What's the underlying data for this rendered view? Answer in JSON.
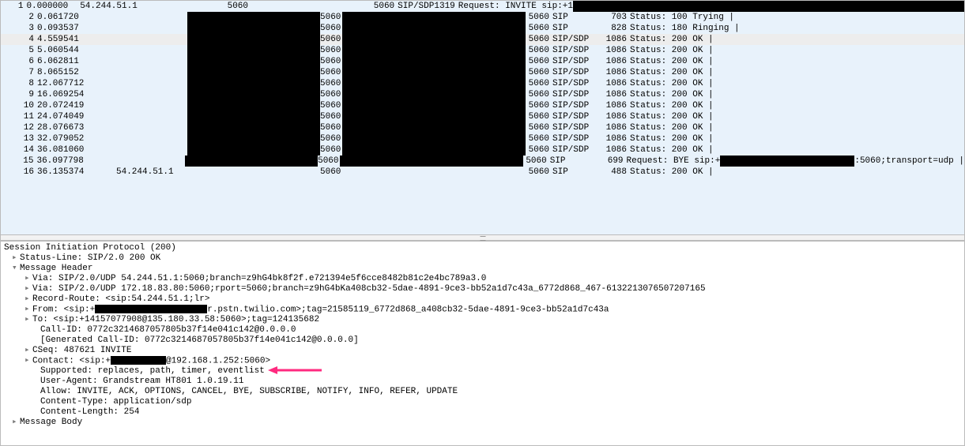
{
  "packets": [
    {
      "no": "1",
      "time": "0.000000",
      "src": "54.244.51.1",
      "srcRedacted": false,
      "port1": "5060",
      "port2": "5060",
      "proto": "SIP/SDP",
      "len": "1319",
      "info_pre": "Request: INVITE sip:+1",
      "info_redact_w": 495,
      "info_post": "",
      "sel": false
    },
    {
      "no": "2",
      "time": "0.061720",
      "src": "",
      "srcRedacted": true,
      "port1": "5060",
      "port2": "5060",
      "proto": "SIP",
      "len": "703",
      "info_pre": "Status: 100 Trying |",
      "info_redact_w": 0,
      "info_post": "",
      "sel": false
    },
    {
      "no": "3",
      "time": "0.093537",
      "src": "",
      "srcRedacted": true,
      "port1": "5060",
      "port2": "5060",
      "proto": "SIP",
      "len": "828",
      "info_pre": "Status: 180 Ringing |",
      "info_redact_w": 0,
      "info_post": "",
      "sel": false
    },
    {
      "no": "4",
      "time": "4.559541",
      "src": "",
      "srcRedacted": true,
      "port1": "5060",
      "port2": "5060",
      "proto": "SIP/SDP",
      "len": "1086",
      "info_pre": "Status: 200 OK |",
      "info_redact_w": 0,
      "info_post": "",
      "sel": true
    },
    {
      "no": "5",
      "time": "5.060544",
      "src": "",
      "srcRedacted": true,
      "port1": "5060",
      "port2": "5060",
      "proto": "SIP/SDP",
      "len": "1086",
      "info_pre": "Status: 200 OK |",
      "info_redact_w": 0,
      "info_post": "",
      "sel": false
    },
    {
      "no": "6",
      "time": "6.062811",
      "src": "",
      "srcRedacted": true,
      "port1": "5060",
      "port2": "5060",
      "proto": "SIP/SDP",
      "len": "1086",
      "info_pre": "Status: 200 OK |",
      "info_redact_w": 0,
      "info_post": "",
      "sel": false
    },
    {
      "no": "7",
      "time": "8.065152",
      "src": "",
      "srcRedacted": true,
      "port1": "5060",
      "port2": "5060",
      "proto": "SIP/SDP",
      "len": "1086",
      "info_pre": "Status: 200 OK |",
      "info_post": "",
      "info_redact_w": 0,
      "sel": false
    },
    {
      "no": "8",
      "time": "12.067712",
      "src": "",
      "srcRedacted": true,
      "port1": "5060",
      "port2": "5060",
      "proto": "SIP/SDP",
      "len": "1086",
      "info_pre": "Status: 200 OK |",
      "info_redact_w": 0,
      "info_post": "",
      "sel": false
    },
    {
      "no": "9",
      "time": "16.069254",
      "src": "",
      "srcRedacted": true,
      "port1": "5060",
      "port2": "5060",
      "proto": "SIP/SDP",
      "len": "1086",
      "info_pre": "Status: 200 OK |",
      "info_redact_w": 0,
      "info_post": "",
      "sel": false
    },
    {
      "no": "10",
      "time": "20.072419",
      "src": "",
      "srcRedacted": true,
      "port1": "5060",
      "port2": "5060",
      "proto": "SIP/SDP",
      "len": "1086",
      "info_pre": "Status: 200 OK |",
      "info_redact_w": 0,
      "info_post": "",
      "sel": false
    },
    {
      "no": "11",
      "time": "24.074049",
      "src": "",
      "srcRedacted": true,
      "port1": "5060",
      "port2": "5060",
      "proto": "SIP/SDP",
      "len": "1086",
      "info_pre": "Status: 200 OK |",
      "info_redact_w": 0,
      "info_post": "",
      "sel": false
    },
    {
      "no": "12",
      "time": "28.076673",
      "src": "",
      "srcRedacted": true,
      "port1": "5060",
      "port2": "5060",
      "proto": "SIP/SDP",
      "len": "1086",
      "info_pre": "Status: 200 OK |",
      "info_redact_w": 0,
      "info_post": "",
      "sel": false
    },
    {
      "no": "13",
      "time": "32.079052",
      "src": "",
      "srcRedacted": true,
      "port1": "5060",
      "port2": "5060",
      "proto": "SIP/SDP",
      "len": "1086",
      "info_pre": "Status: 200 OK |",
      "info_redact_w": 0,
      "info_post": "",
      "sel": false
    },
    {
      "no": "14",
      "time": "36.081060",
      "src": "",
      "srcRedacted": true,
      "port1": "5060",
      "port2": "5060",
      "proto": "SIP/SDP",
      "len": "1086",
      "info_pre": "Status: 200 OK |",
      "info_redact_w": 0,
      "info_post": "",
      "sel": false
    },
    {
      "no": "15",
      "time": "36.097798",
      "src": "",
      "srcRedacted": true,
      "port1": "5060",
      "port2": "5060",
      "proto": "SIP",
      "len": "699",
      "info_pre": "Request: BYE sip:+",
      "info_redact_w": 170,
      "info_post": ":5060;transport=udp |",
      "sel": false
    },
    {
      "no": "16",
      "time": "36.135374",
      "src": "54.244.51.1",
      "srcRedacted": false,
      "port1": "5060",
      "port2": "5060",
      "proto": "SIP",
      "len": "488",
      "info_pre": "Status: 200 OK |",
      "info_redact_w": 0,
      "info_post": "",
      "sel": false
    }
  ],
  "detail": {
    "root": "Session Initiation Protocol (200)",
    "status_line": "Status-Line: SIP/2.0 200 OK",
    "msg_header": "Message Header",
    "via1": "Via: SIP/2.0/UDP 54.244.51.1:5060;branch=z9hG4bk8f2f.e721394e5f6cce8482b81c2e4bc789a3.0",
    "via2": "Via: SIP/2.0/UDP 172.18.83.80:5060;rport=5060;branch=z9hG4bKa408cb32-5dae-4891-9ce3-bb52a1d7c43a_6772d868_467-6132213076507207165",
    "record_route": "Record-Route: <sip:54.244.51.1;lr>",
    "from_pre": "From: <sip:+",
    "from_post": "r.pstn.twilio.com>;tag=21585119_6772d868_a408cb32-5dae-4891-9ce3-bb52a1d7c43a",
    "to": "To: <sip:+14157077908@135.180.33.58:5060>;tag=124135682",
    "callid": "Call-ID: 0772c3214687057805b37f14e041c142@0.0.0.0",
    "gen_callid": "[Generated Call-ID: 0772c3214687057805b37f14e041c142@0.0.0.0]",
    "cseq": "CSeq: 487621 INVITE",
    "contact_pre": "Contact: <sip:+",
    "contact_post": "@192.168.1.252:5060>",
    "supported": "Supported: replaces, path, timer, eventlist",
    "ua": "User-Agent: Grandstream HT801 1.0.19.11",
    "allow": "Allow: INVITE, ACK, OPTIONS, CANCEL, BYE, SUBSCRIBE, NOTIFY, INFO, REFER, UPDATE",
    "ctype": "Content-Type: application/sdp",
    "clen": "Content-Length:   254",
    "msg_body": "Message Body"
  }
}
